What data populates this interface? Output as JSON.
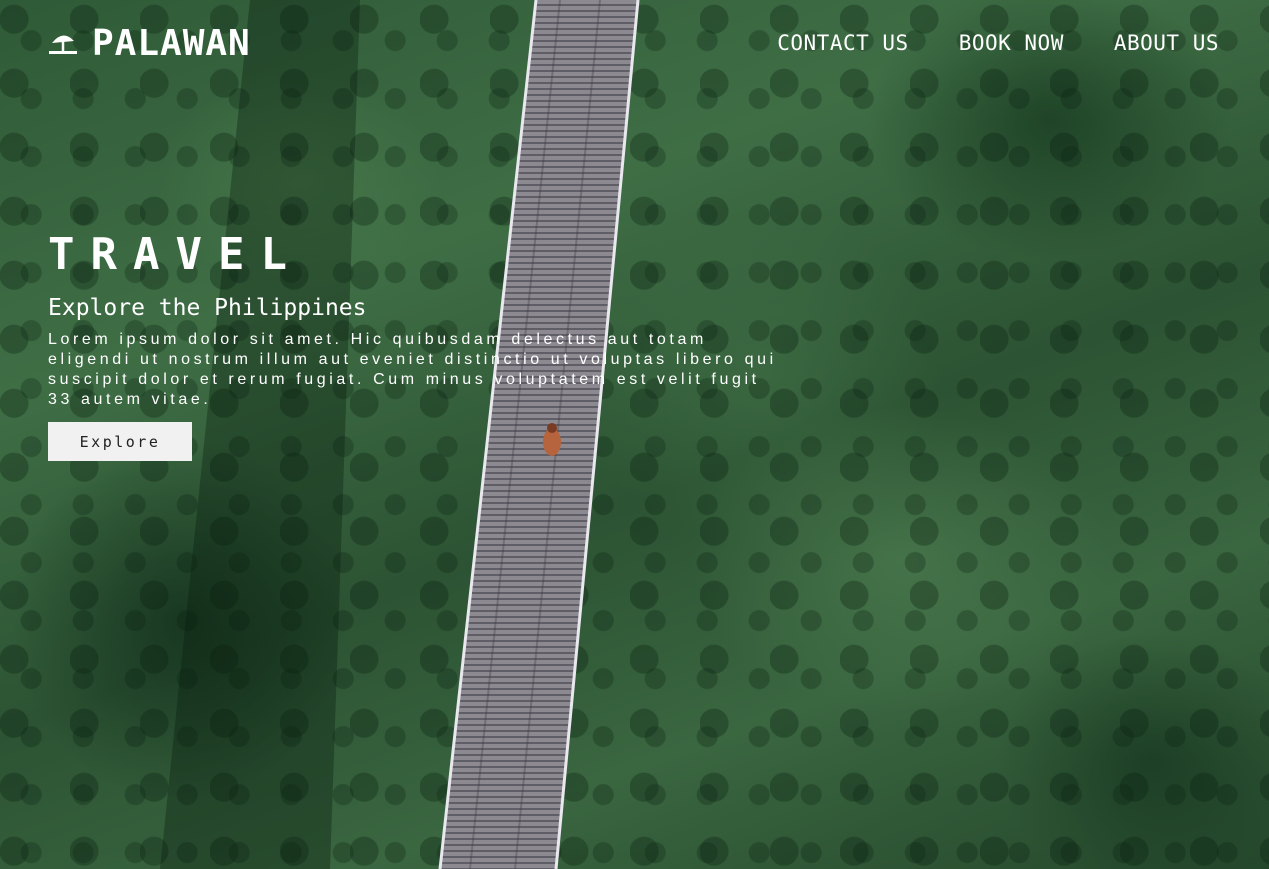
{
  "brand": {
    "name": "PALAWAN",
    "icon": "beach-umbrella-icon"
  },
  "nav": {
    "items": [
      {
        "label": "CONTACT US"
      },
      {
        "label": "BOOK NOW"
      },
      {
        "label": "ABOUT US"
      }
    ]
  },
  "hero": {
    "title": "TRAVEL",
    "subtitle": "Explore the Philippines",
    "body": "Lorem ipsum dolor sit amet. Hic quibusdam delectus aut totam eligendi ut nostrum illum aut eveniet distinctio ut voluptas libero qui suscipit dolor et rerum fugiat. Cum minus voluptatem est velit fugit 33 autem vitae.",
    "cta_label": "Explore"
  },
  "colors": {
    "text": "#ffffff",
    "button_bg": "#f1f1f1",
    "button_text": "#222222",
    "forest": "#2f5a37"
  }
}
